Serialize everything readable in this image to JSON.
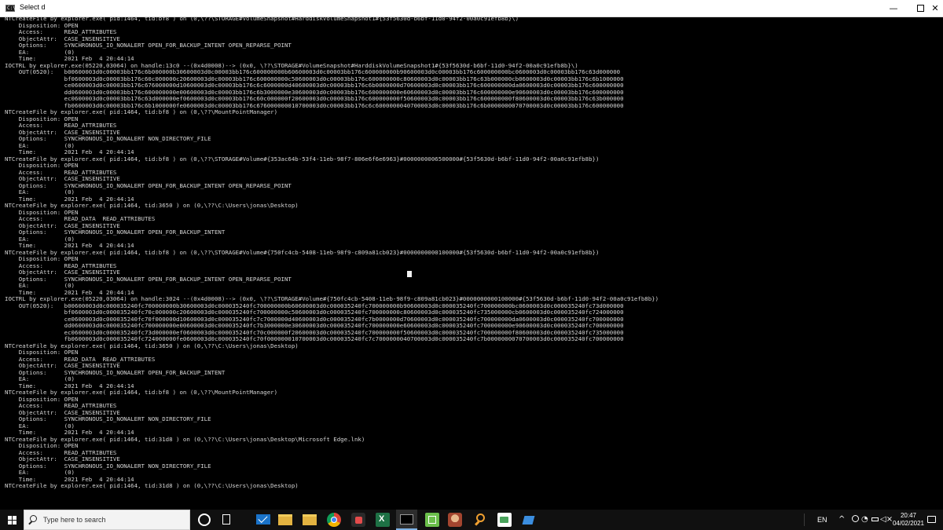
{
  "window": {
    "title": "Select d",
    "app_icon_glyph": "C:\\",
    "minimize_glyph": "—",
    "close_glyph": "✕"
  },
  "console": {
    "text_color": "#d4d4d4",
    "background": "#000000",
    "lines": [
      "NTCreateFile by explorer.exe( pid:1464, tid:bf8 ) on (0,\\??\\STORAGE#VolumeSnapshot#HarddiskVolumeSnapshot1#{53f5630d-b6bf-11d0-94f2-00a0c91efb8b}\\)",
      "    Disposition: OPEN",
      "    Access:      READ_ATTRIBUTES",
      "    ObjectAttr:  CASE_INSENSITIVE",
      "    Options:     SYNCHRONOUS_IO_NONALERT OPEN_FOR_BACKUP_INTENT OPEN_REPARSE_POINT",
      "    EA:          (0)",
      "    Time:        2021 Feb  4 20:44:14",
      "IOCTRL by explorer.exe(05220,03064) on handle:13c0 --(0x4d0008)--> (0x0, \\??\\STORAGE#VolumeSnapshot#HarddiskVolumeSnapshot1#{53f5630d-b6bf-11d0-94f2-00a0c91efb8b}\\)",
      "    OUT(0520):   b00600003d0c00003bb176c6b000000b30600003d0c00003bb176c600000000b60600003d0c00003bb176c600000000b90600003d0c00003bb176c600000000bc0600003d0c00003bb176c63d000000",
      "                 bf0600003d0c00003bb176c60c000000c20600003d0c00003bb176c600000000c50600003d0c00003bb176c600000000c80600003d0c00003bb176c63b000000cb0600003d0c00003bb176c6b1000000",
      "                 ce0600003d0c00003bb176c676000000d10600003d0c00003bb176c6c6000000d40600003d0c00003bb176c6b0000000d70600003d0c00003bb176c600000000da0600003d0c00003bb176c600000000",
      "                 dd0600003d0c00003bb176c600000000e00600003d0c00003bb176c6b3000000e30600003d0c00003bb176c600000000e60600003d0c00003bb176c600000000e90600003d0c00003bb176c600000000",
      "                 ec0600003d0c00003bb176c63d000000ef0600003d0c00003bb176c60c000000f20600003d0c00003bb176c600000000f50600003d0c00003bb176c600000000f80600003d0c00003bb176c63b000000",
      "                 fb0600003d0c00003bb176c6b1000000fe0600003d0c00003bb176c676000000010700003d0c00003bb176c6c6000000040700003d0c00003bb176c6b0000000070700003d0c00003bb176c600000000",
      "NTCreateFile by explorer.exe( pid:1464, tid:bf8 ) on (0,\\??\\MountPointManager)",
      "    Disposition: OPEN",
      "    Access:      READ_ATTRIBUTES",
      "    ObjectAttr:  CASE_INSENSITIVE",
      "    Options:     SYNCHRONOUS_IO_NONALERT NON_DIRECTORY_FILE",
      "    EA:          (0)",
      "    Time:        2021 Feb  4 20:44:14",
      "NTCreateFile by explorer.exe( pid:1464, tid:bf8 ) on (0,\\??\\STORAGE#Volume#{353ac64b-53f4-11eb-98f7-806e6f6e6963}#0000000006500000#{53f5630d-b6bf-11d0-94f2-00a0c91efb8b})",
      "    Disposition: OPEN",
      "    Access:      READ_ATTRIBUTES",
      "    ObjectAttr:  CASE_INSENSITIVE",
      "    Options:     SYNCHRONOUS_IO_NONALERT OPEN_FOR_BACKUP_INTENT OPEN_REPARSE_POINT",
      "    EA:          (0)",
      "    Time:        2021 Feb  4 20:44:14",
      "NTCreateFile by explorer.exe( pid:1464, tid:3650 ) on (0,\\??\\C:\\Users\\jonas\\Desktop)",
      "    Disposition: OPEN",
      "    Access:      READ_DATA  READ_ATTRIBUTES",
      "    ObjectAttr:  CASE_INSENSITIVE",
      "    Options:     SYNCHRONOUS_IO_NONALERT OPEN_FOR_BACKUP_INTENT",
      "    EA:          (0)",
      "    Time:        2021 Feb  4 20:44:14",
      "NTCreateFile by explorer.exe( pid:1464, tid:bf8 ) on (0,\\??\\STORAGE#Volume#{750fc4cb-5408-11eb-98f9-c809a81cb023}#0000000000100000#{53f5630d-b6bf-11d0-94f2-00a0c91efb8b})",
      "    Disposition: OPEN",
      "    Access:      READ_ATTRIBUTES",
      "    ObjectAttr:  CASE_INSENSITIVE",
      "    Options:     SYNCHRONOUS_IO_NONALERT OPEN_FOR_BACKUP_INTENT OPEN_REPARSE_POINT",
      "    EA:          (0)",
      "    Time:        2021 Feb  4 20:44:14",
      "IOCTRL by explorer.exe(05220,03064) on handle:3024 --(0x4d0008)--> (0x0, \\??\\STORAGE#Volume#{750fc4cb-5408-11eb-98f9-c809a81cb023}#0000000000100000#{53f5630d-b6bf-11d0-94f2-00a0c91efb8b})",
      "    OUT(0520):   b00600003d0c000035240fc700000000b30600003d0c000035240fc700000000b60600003d0c000035240fc700000000b90600003d0c000035240fc700000000bc0600003d0c000035240fc73d000000",
      "                 bf0600003d0c000035240fc70c000000c20600003d0c000035240fc700000000c50600003d0c000035240fc700000000c80600003d0c000035240fc735000000cb0600003d0c000035240fc724000000",
      "                 ce0600003d0c000035240fc70f000000d10600003d0c000035240fc7c7000000d40600003d0c000035240fc7b0000000d70600003d0c000035240fc700000000da0600003d0c000035240fc700000000",
      "                 dd0600003d0c000035240fc700000000e00600003d0c000035240fc7b3000000e30600003d0c000035240fc700000000e60600003d0c000035240fc700000000e90600003d0c000035240fc700000000",
      "                 ec0600003d0c000035240fc73d000000ef0600003d0c000035240fc70c000000f20600003d0c000035240fc700000000f50600003d0c000035240fc700000000f80600003d0c000035240fc735000000",
      "                 fb0600003d0c000035240fc724000000fe0600003d0c000035240fc70f000000010700003d0c000035240fc7c7000000040700003d0c000035240fc7b0000000070700003d0c000035240fc700000000",
      "NTCreateFile by explorer.exe( pid:1464, tid:3650 ) on (0,\\??\\C:\\Users\\jonas\\Desktop)",
      "    Disposition: OPEN",
      "    Access:      READ_DATA  READ_ATTRIBUTES",
      "    ObjectAttr:  CASE_INSENSITIVE",
      "    Options:     SYNCHRONOUS_IO_NONALERT OPEN_FOR_BACKUP_INTENT",
      "    EA:          (0)",
      "    Time:        2021 Feb  4 20:44:14",
      "NTCreateFile by explorer.exe( pid:1464, tid:bf8 ) on (0,\\??\\MountPointManager)",
      "    Disposition: OPEN",
      "    Access:      READ_ATTRIBUTES",
      "    ObjectAttr:  CASE_INSENSITIVE",
      "    Options:     SYNCHRONOUS_IO_NONALERT NON_DIRECTORY_FILE",
      "    EA:          (0)",
      "    Time:        2021 Feb  4 20:44:14",
      "NTCreateFile by explorer.exe( pid:1464, tid:31d8 ) on (0,\\??\\C:\\Users\\jonas\\Desktop\\Microsoft Edge.lnk)",
      "    Disposition: OPEN",
      "    Access:      READ_ATTRIBUTES",
      "    ObjectAttr:  CASE_INSENSITIVE",
      "    Options:     SYNCHRONOUS_IO_NONALERT NON_DIRECTORY_FILE",
      "    EA:          (0)",
      "    Time:        2021 Feb  4 20:44:14",
      "NTCreateFile by explorer.exe( pid:1464, tid:31d8 ) on (0,\\??\\C:\\Users\\jonas\\Desktop)"
    ]
  },
  "taskbar": {
    "search_placeholder": "Type here to search",
    "pinned_apps": [
      "cortana-icon",
      "task-view-icon",
      "mail-icon",
      "file-explorer-icon",
      "folder-icon",
      "chrome-icon",
      "app-icon",
      "excel-icon",
      "command-prompt-icon",
      "spreadsheet-icon",
      "photo-icon",
      "search-app-icon",
      "image-viewer-icon",
      "visual-studio-icon"
    ],
    "language": "EN",
    "tray_chevron": "^",
    "volume_glyph": "◁×",
    "wifi_glyph": "◔",
    "clock_time": "20:47",
    "clock_date": "04/02/2021",
    "accent_color": "#7fb3e5"
  }
}
